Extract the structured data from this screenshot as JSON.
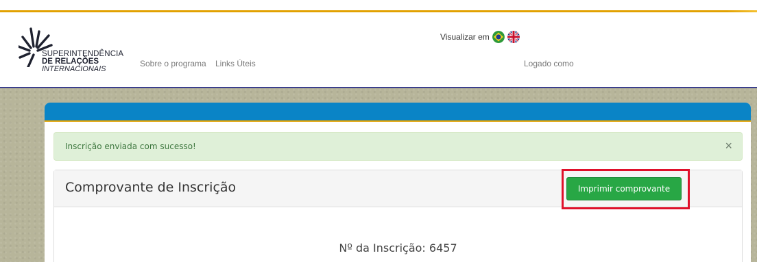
{
  "header": {
    "logo": {
      "line1": "SUPERINTENDÊNCIA",
      "line2": "DE RELAÇÕES",
      "line3": "INTERNACIONAIS"
    },
    "nav": [
      "Sobre o programa",
      "Links Úteis"
    ],
    "language_label": "Visualizar em",
    "language_flags": [
      "brazil-flag-icon",
      "uk-flag-icon"
    ],
    "logged_as": "Logado como"
  },
  "alert": {
    "message": "Inscrição enviada com sucesso!",
    "close": "×"
  },
  "card": {
    "title": "Comprovante de Inscrição",
    "print_button": "Imprimir comprovante",
    "registration_number": "Nº da Inscrição: 6457"
  },
  "colors": {
    "accent_bar": "#0a84c6",
    "accent_line": "#e2a100",
    "success_button": "#28a745",
    "highlight_box": "#e0102a"
  }
}
